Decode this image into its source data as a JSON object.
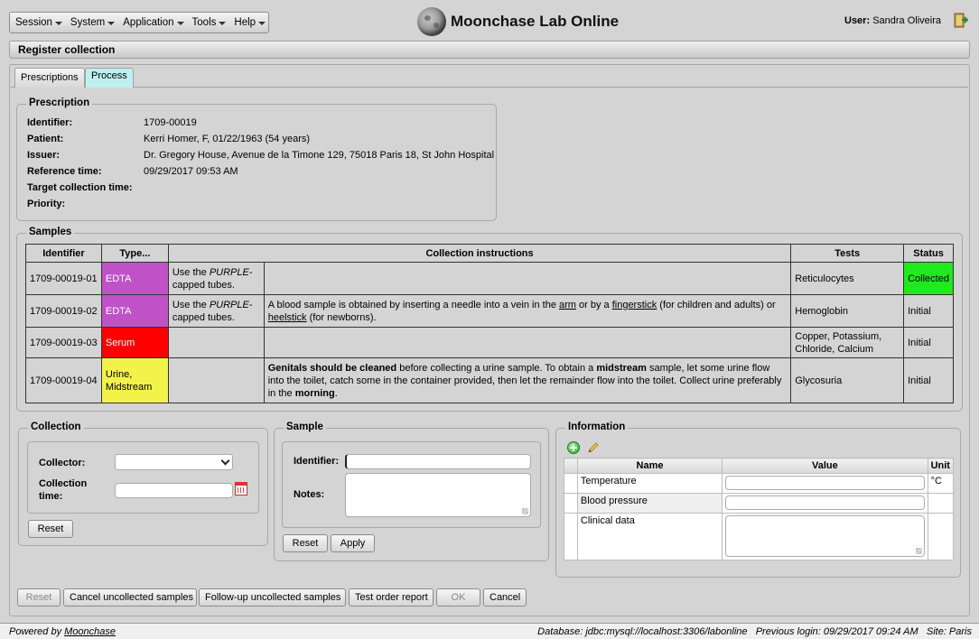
{
  "menu": {
    "items": [
      "Session",
      "System",
      "Application",
      "Tools",
      "Help"
    ]
  },
  "header": {
    "app_title": "Moonchase Lab Online",
    "user_label": "User:",
    "user_name": "Sandra Oliveira"
  },
  "page": {
    "title": "Register collection"
  },
  "tabs": {
    "prescriptions": "Prescriptions",
    "process": "Process"
  },
  "prescription": {
    "legend": "Prescription",
    "fields": [
      {
        "label": "Identifier:",
        "value": "1709-00019"
      },
      {
        "label": "Patient:",
        "value": "Kerri Homer, F, 01/22/1963 (54 years)"
      },
      {
        "label": "Issuer:",
        "value": "Dr. Gregory House, Avenue de la Timone 129, 75018 Paris 18, St John Hospital"
      },
      {
        "label": "Reference time:",
        "value": "09/29/2017 09:53 AM"
      },
      {
        "label": "Target collection time:",
        "value": ""
      },
      {
        "label": "Priority:",
        "value": ""
      }
    ]
  },
  "samples": {
    "legend": "Samples",
    "headers": [
      "Identifier",
      "Type...",
      "Collection instructions",
      "Tests",
      "Status"
    ],
    "rows": [
      {
        "id": "1709-00019-01",
        "type": "EDTA",
        "type_color": "#c052c8",
        "tube_pre": "Use the ",
        "tube_em": "PURPLE",
        "tube_post": "-capped tubes.",
        "tests": "Reticulocytes",
        "status": "Collected"
      },
      {
        "id": "1709-00019-02",
        "type": "EDTA",
        "type_color": "#c052c8",
        "tube_pre": "Use the ",
        "tube_em": "PURPLE",
        "tube_post": "-capped tubes.",
        "instr_a": "A blood sample is obtained by inserting a needle into a vein in the ",
        "instr_link1": "arm",
        "instr_b": " or by a ",
        "instr_link2": "fingerstick",
        "instr_c": " (for children and adults) or ",
        "instr_link3": "heelstick",
        "instr_d": " (for newborns).",
        "tests": "Hemoglobin",
        "status": "Initial"
      },
      {
        "id": "1709-00019-03",
        "type": "Serum",
        "type_color": "#ff0000",
        "tests": "Copper, Potassium, Chloride, Calcium",
        "status": "Initial"
      },
      {
        "id": "1709-00019-04",
        "type": "Urine, Midstream",
        "type_color": "#f2f24a",
        "u_b1": "Genitals should be cleaned",
        "u_t1": " before collecting a urine sample. To obtain a ",
        "u_b2": "midstream",
        "u_t2": " sample, let some urine flow into the toilet, catch some in the container provided, then let the remainder flow into the toilet. Collect urine preferably in the ",
        "u_b3": "morning",
        "u_t3": ".",
        "tests": "Glycosuria",
        "status": "Initial"
      }
    ],
    "status_collected_color": "#1eea1e"
  },
  "collection": {
    "legend": "Collection",
    "collector_label": "Collector:",
    "collector_value": "",
    "time_label": "Collection time:",
    "time_value": "",
    "reset": "Reset"
  },
  "sample": {
    "legend": "Sample",
    "identifier_label": "Identifier:",
    "identifier_value": "",
    "notes_label": "Notes:",
    "notes_value": "",
    "reset": "Reset",
    "apply": "Apply"
  },
  "information": {
    "legend": "Information",
    "headers": [
      "Name",
      "Value",
      "Unit"
    ],
    "rows": [
      {
        "name": "Temperature",
        "value": "",
        "unit": "°C"
      },
      {
        "name": "Blood pressure",
        "value": "",
        "unit": ""
      },
      {
        "name": "Clinical data",
        "value": "",
        "unit": ""
      }
    ]
  },
  "actions": [
    "Reset",
    "Cancel uncollected samples",
    "Follow-up uncollected samples",
    "Test order report",
    "OK",
    "Cancel"
  ],
  "footer": {
    "powered_prefix": "Powered by ",
    "powered_link": "Moonchase",
    "database": "Database: jdbc:mysql://localhost:3306/labonline",
    "previous_login": "Previous login: 09/29/2017 09:24 AM",
    "site": "Site: Paris"
  },
  "icons": [
    "chevron-down-icon",
    "moon-logo-icon",
    "exit-icon",
    "calendar-icon",
    "add-icon",
    "edit-icon"
  ]
}
